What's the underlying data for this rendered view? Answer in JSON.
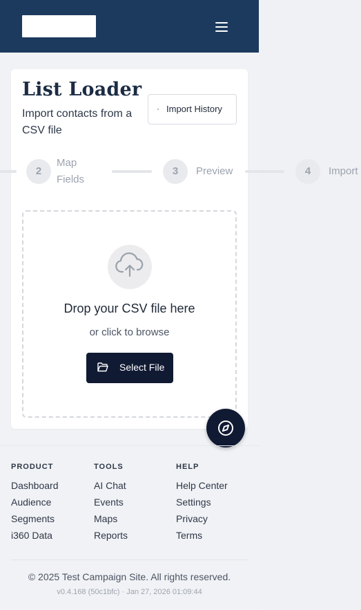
{
  "header": {
    "menu_icon": "hamburger-menu-icon"
  },
  "page": {
    "title": "List Loader",
    "subtitle": "Import contacts from a CSV file",
    "import_history_label": "Import History",
    "import_history_icon": "history-icon"
  },
  "steps": [
    {
      "number": "2",
      "label": "Map Fields"
    },
    {
      "number": "3",
      "label": "Preview"
    },
    {
      "number": "4",
      "label": "Import"
    }
  ],
  "dropzone": {
    "icon": "cloud-upload-icon",
    "title": "Drop your CSV file here",
    "subtitle": "or click to browse",
    "button_label": "Select File",
    "button_icon": "folder-open-icon"
  },
  "fab": {
    "icon": "compass-icon"
  },
  "footer": {
    "columns": [
      {
        "heading": "PRODUCT",
        "links": [
          "Dashboard",
          "Audience",
          "Segments",
          "i360 Data"
        ]
      },
      {
        "heading": "TOOLS",
        "links": [
          "AI Chat",
          "Events",
          "Maps",
          "Reports"
        ]
      },
      {
        "heading": "HELP",
        "links": [
          "Help Center",
          "Settings",
          "Privacy",
          "Terms"
        ]
      }
    ],
    "copyright": "© 2025 Test Campaign Site. All rights reserved.",
    "version": "v0.4.168 (50c1bfc) · Jan 27, 2026 01:09:44"
  },
  "colors": {
    "header_bg": "#1c3a5e",
    "primary_button": "#101a33"
  }
}
